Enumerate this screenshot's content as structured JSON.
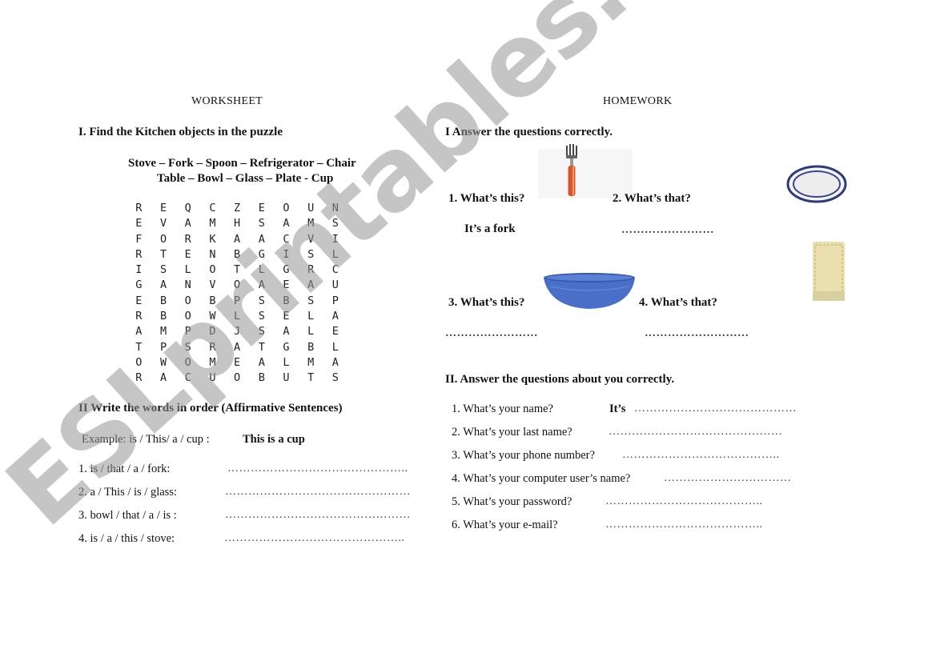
{
  "worksheet": {
    "title": "WORKSHEET",
    "section1": {
      "heading": "I.   Find the Kitchen objects  in the puzzle",
      "word_list_line1": "Stove – Fork – Spoon – Refrigerator – Chair",
      "word_list_line2": "Table – Bowl – Glass – Plate - Cup",
      "puzzle": [
        [
          "R",
          "E",
          "Q",
          "C",
          "Z",
          "E",
          "O",
          "U",
          "N"
        ],
        [
          "E",
          "V",
          "A",
          "M",
          "H",
          "S",
          "A",
          "M",
          "S"
        ],
        [
          "F",
          "O",
          "R",
          "K",
          "A",
          "A",
          "C",
          "V",
          "I"
        ],
        [
          "R",
          "T",
          "E",
          "N",
          "B",
          "G",
          "I",
          "S",
          "L"
        ],
        [
          "I",
          "S",
          "L",
          "O",
          "T",
          "L",
          "G",
          "R",
          "C"
        ],
        [
          "G",
          "A",
          "N",
          "V",
          "O",
          "A",
          "E",
          "A",
          "U"
        ],
        [
          "E",
          "B",
          "O",
          "B",
          "P",
          "S",
          "B",
          "S",
          "P"
        ],
        [
          "R",
          "B",
          "O",
          "W",
          "L",
          "S",
          "E",
          "L",
          "A"
        ],
        [
          "A",
          "M",
          "P",
          "D",
          "J",
          "S",
          "A",
          "L",
          "E"
        ],
        [
          "T",
          "P",
          "S",
          "R",
          "A",
          "T",
          "G",
          "B",
          "L"
        ],
        [
          "O",
          "W",
          "O",
          "M",
          "E",
          "A",
          "L",
          "M",
          "A"
        ],
        [
          "R",
          "A",
          "C",
          "U",
          "O",
          "B",
          "U",
          "T",
          "S"
        ]
      ]
    },
    "section2": {
      "heading": "II Write the words in order (Affirmative Sentences)",
      "example_prompt": "Example:  is / This/ a / cup :",
      "example_answer": "This is a cup",
      "items": [
        {
          "prompt": "1. is / that / a  / fork:",
          "blank": "……………………………………….."
        },
        {
          "prompt": "2. a / This / is / glass:",
          "blank": "…………………………………………"
        },
        {
          "prompt": "3. bowl / that / a / is :",
          "blank": "…………………………………………"
        },
        {
          "prompt": "4. is / a / this / stove:",
          "blank": "……………………………………….."
        }
      ]
    }
  },
  "homework": {
    "title": "HOMEWORK",
    "section1": {
      "heading": "I  Answer the questions correctly.",
      "q1": "1. What’s this?",
      "q1_answer": "It’s a fork",
      "q2": "2. What’s that?",
      "q2_blank": "……………………",
      "q3": "3. What’s this?",
      "q3_blank": "……………………",
      "q4": "4. What’s that?",
      "q4_blank": "………………………",
      "images": [
        "fork",
        "plate",
        "bowl",
        "napkin"
      ]
    },
    "section2": {
      "heading": "II. Answer the questions about you correctly.",
      "items": [
        {
          "question": "1. What’s your name?",
          "prefix": "It’s",
          "blank": "……………………………………"
        },
        {
          "question": "2. What’s your last name?",
          "prefix": "",
          "blank": "………………………………………"
        },
        {
          "question": "3. What’s your phone number?",
          "prefix": "",
          "blank": "………………………………….."
        },
        {
          "question": "4. What’s your computer user’s name?",
          "prefix": "",
          "blank": "……………………………"
        },
        {
          "question": "5. What’s your password?",
          "prefix": "",
          "blank": "………………………………….."
        },
        {
          "question": "6. What’s your e-mail?",
          "prefix": "",
          "blank": "………………………………….."
        }
      ]
    }
  },
  "watermark": "ESLprintables.com"
}
